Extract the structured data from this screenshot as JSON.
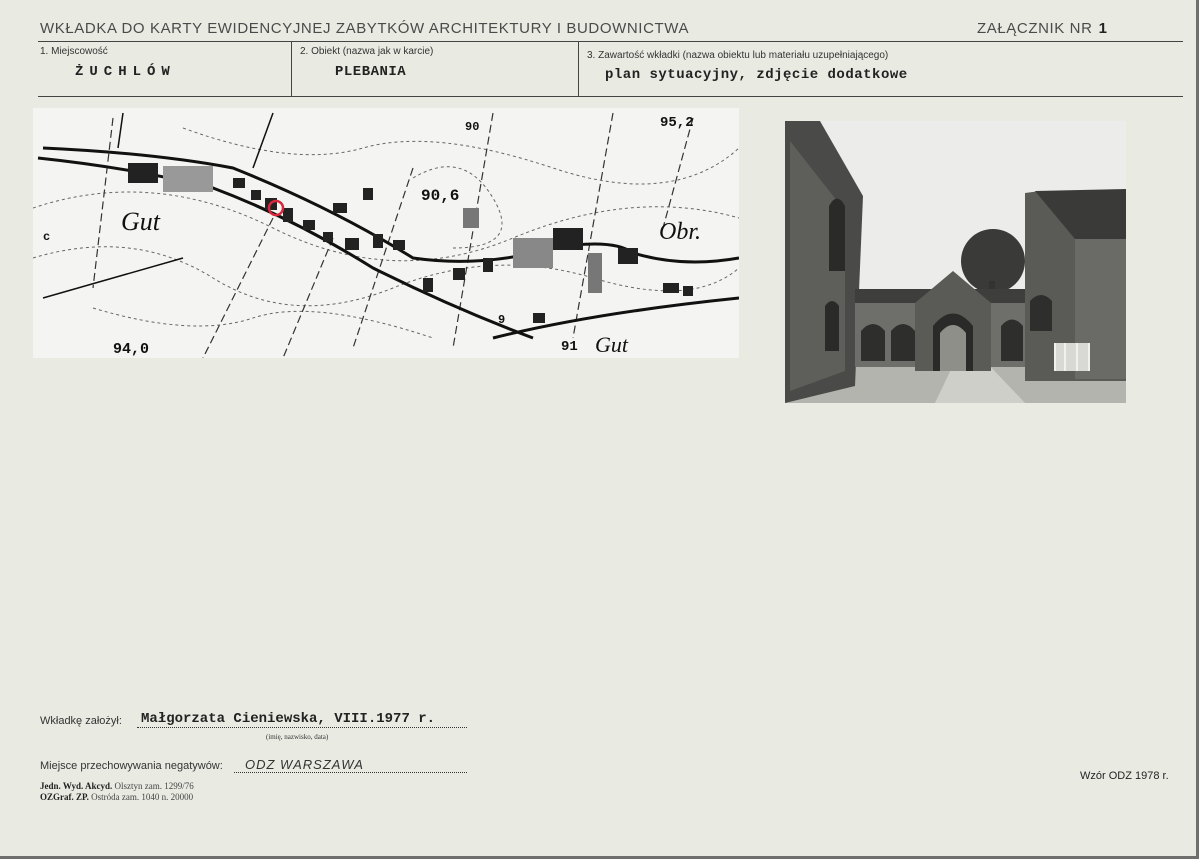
{
  "header": {
    "title": "WKŁADKA DO KARTY EWIDENCYJNEJ ZABYTKÓW ARCHITEKTURY I BUDOWNICTWA",
    "attachment_label": "ZAŁĄCZNIK NR",
    "attachment_number": "1"
  },
  "fields": {
    "locality_label": "1. Miejscowość",
    "locality_value": "ŻUCHLÓW",
    "object_label": "2. Obiekt (nazwa jak w karcie)",
    "object_value": "PLEBANIA",
    "content_label": "3. Zawartość wkładki (nazwa obiektu lub materiału uzupełniającego)",
    "content_value": "plan sytuacyjny, zdjęcie dodatkowe"
  },
  "map": {
    "labels": [
      "Gut",
      "Obr.",
      "Gut",
      "90,6",
      "95,2",
      "94,0",
      "91",
      "90",
      "9",
      "c"
    ],
    "marker_color": "#d6283a"
  },
  "footer": {
    "founder_label": "Wkładkę założył:",
    "founder_value": "Małgorzata Cieniewska, VIII.1977 r.",
    "founder_hint": "(imię, nazwisko, data)",
    "negatives_label": "Miejsce przechowywania negatywów:",
    "negatives_value": "ODZ WARSZAWA",
    "print_line1_bold": "Jedn. Wyd. Akcyd.",
    "print_line1": "Olsztyn zam. 1299/76",
    "print_line2_bold": "OZGraf. ZP.",
    "print_line2": "Ostróda zam. 1040 n. 20000",
    "template": "Wzór ODZ 1978 r."
  }
}
